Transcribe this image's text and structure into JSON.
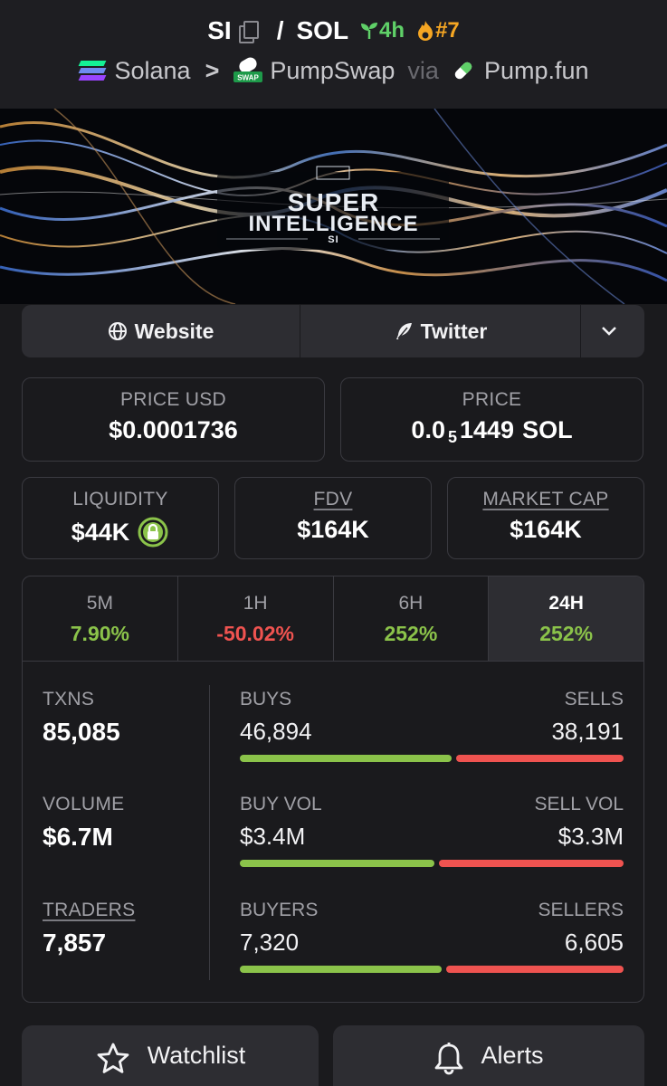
{
  "header": {
    "base_symbol": "SI",
    "quote_symbol": "SOL",
    "age": "4h",
    "rank": "#7",
    "chain": "Solana",
    "dex": "PumpSwap",
    "via_label": "via",
    "launchpad": "Pump.fun",
    "swap_logo_text": "SWAP"
  },
  "banner": {
    "line1": "SUPER",
    "line2": "INTELLIGENCE",
    "line3": "SI"
  },
  "links": {
    "website": "Website",
    "twitter": "Twitter"
  },
  "price": {
    "usd_label": "PRICE USD",
    "usd_value": "$0.0001736",
    "native_label": "PRICE",
    "native_prefix": "0.0",
    "native_zeros": "5",
    "native_digits": "1449",
    "native_unit": "SOL"
  },
  "metrics": {
    "liquidity_label": "LIQUIDITY",
    "liquidity_value": "$44K",
    "fdv_label": "FDV",
    "fdv_value": "$164K",
    "mcap_label": "MARKET CAP",
    "mcap_value": "$164K"
  },
  "tabs": [
    {
      "label": "5M",
      "value": "7.90%"
    },
    {
      "label": "1H",
      "value": "-50.02%"
    },
    {
      "label": "6H",
      "value": "252%"
    },
    {
      "label": "24H",
      "value": "252%"
    }
  ],
  "stats": {
    "txns_label": "TXNS",
    "txns_value": "85,085",
    "volume_label": "VOLUME",
    "volume_value": "$6.7M",
    "traders_label": "TRADERS",
    "traders_value": "7,857",
    "buys_label": "BUYS",
    "buys_value": "46,894",
    "sells_label": "SELLS",
    "sells_value": "38,191",
    "buys_ratio": 0.551,
    "buyvol_label": "BUY VOL",
    "buyvol_value": "$3.4M",
    "sellvol_label": "SELL VOL",
    "sellvol_value": "$3.3M",
    "buyvol_ratio": 0.507,
    "buyers_label": "BUYERS",
    "buyers_value": "7,320",
    "sellers_label": "SELLERS",
    "sellers_value": "6,605",
    "buyers_ratio": 0.526
  },
  "actions": {
    "watchlist": "Watchlist",
    "alerts": "Alerts"
  },
  "colors": {
    "positive": "#8bc34a",
    "negative": "#ef5350",
    "age_green": "#5fd068",
    "rank_orange": "#f5a623"
  }
}
